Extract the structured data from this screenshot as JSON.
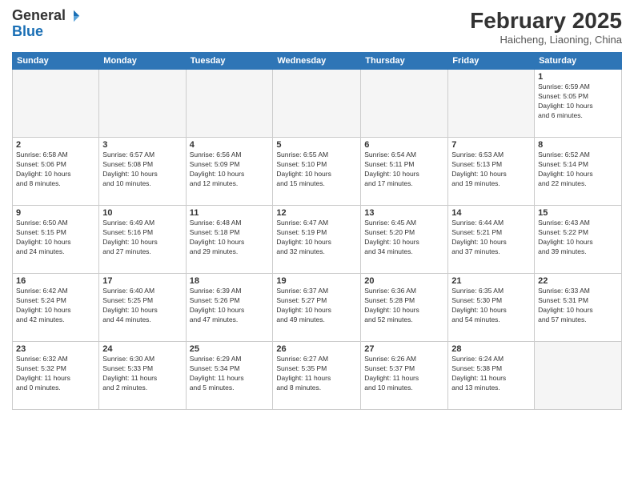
{
  "header": {
    "logo_general": "General",
    "logo_blue": "Blue",
    "month_title": "February 2025",
    "location": "Haicheng, Liaoning, China"
  },
  "weekdays": [
    "Sunday",
    "Monday",
    "Tuesday",
    "Wednesday",
    "Thursday",
    "Friday",
    "Saturday"
  ],
  "weeks": [
    [
      {
        "day": "",
        "info": ""
      },
      {
        "day": "",
        "info": ""
      },
      {
        "day": "",
        "info": ""
      },
      {
        "day": "",
        "info": ""
      },
      {
        "day": "",
        "info": ""
      },
      {
        "day": "",
        "info": ""
      },
      {
        "day": "1",
        "info": "Sunrise: 6:59 AM\nSunset: 5:05 PM\nDaylight: 10 hours\nand 6 minutes."
      }
    ],
    [
      {
        "day": "2",
        "info": "Sunrise: 6:58 AM\nSunset: 5:06 PM\nDaylight: 10 hours\nand 8 minutes."
      },
      {
        "day": "3",
        "info": "Sunrise: 6:57 AM\nSunset: 5:08 PM\nDaylight: 10 hours\nand 10 minutes."
      },
      {
        "day": "4",
        "info": "Sunrise: 6:56 AM\nSunset: 5:09 PM\nDaylight: 10 hours\nand 12 minutes."
      },
      {
        "day": "5",
        "info": "Sunrise: 6:55 AM\nSunset: 5:10 PM\nDaylight: 10 hours\nand 15 minutes."
      },
      {
        "day": "6",
        "info": "Sunrise: 6:54 AM\nSunset: 5:11 PM\nDaylight: 10 hours\nand 17 minutes."
      },
      {
        "day": "7",
        "info": "Sunrise: 6:53 AM\nSunset: 5:13 PM\nDaylight: 10 hours\nand 19 minutes."
      },
      {
        "day": "8",
        "info": "Sunrise: 6:52 AM\nSunset: 5:14 PM\nDaylight: 10 hours\nand 22 minutes."
      }
    ],
    [
      {
        "day": "9",
        "info": "Sunrise: 6:50 AM\nSunset: 5:15 PM\nDaylight: 10 hours\nand 24 minutes."
      },
      {
        "day": "10",
        "info": "Sunrise: 6:49 AM\nSunset: 5:16 PM\nDaylight: 10 hours\nand 27 minutes."
      },
      {
        "day": "11",
        "info": "Sunrise: 6:48 AM\nSunset: 5:18 PM\nDaylight: 10 hours\nand 29 minutes."
      },
      {
        "day": "12",
        "info": "Sunrise: 6:47 AM\nSunset: 5:19 PM\nDaylight: 10 hours\nand 32 minutes."
      },
      {
        "day": "13",
        "info": "Sunrise: 6:45 AM\nSunset: 5:20 PM\nDaylight: 10 hours\nand 34 minutes."
      },
      {
        "day": "14",
        "info": "Sunrise: 6:44 AM\nSunset: 5:21 PM\nDaylight: 10 hours\nand 37 minutes."
      },
      {
        "day": "15",
        "info": "Sunrise: 6:43 AM\nSunset: 5:22 PM\nDaylight: 10 hours\nand 39 minutes."
      }
    ],
    [
      {
        "day": "16",
        "info": "Sunrise: 6:42 AM\nSunset: 5:24 PM\nDaylight: 10 hours\nand 42 minutes."
      },
      {
        "day": "17",
        "info": "Sunrise: 6:40 AM\nSunset: 5:25 PM\nDaylight: 10 hours\nand 44 minutes."
      },
      {
        "day": "18",
        "info": "Sunrise: 6:39 AM\nSunset: 5:26 PM\nDaylight: 10 hours\nand 47 minutes."
      },
      {
        "day": "19",
        "info": "Sunrise: 6:37 AM\nSunset: 5:27 PM\nDaylight: 10 hours\nand 49 minutes."
      },
      {
        "day": "20",
        "info": "Sunrise: 6:36 AM\nSunset: 5:28 PM\nDaylight: 10 hours\nand 52 minutes."
      },
      {
        "day": "21",
        "info": "Sunrise: 6:35 AM\nSunset: 5:30 PM\nDaylight: 10 hours\nand 54 minutes."
      },
      {
        "day": "22",
        "info": "Sunrise: 6:33 AM\nSunset: 5:31 PM\nDaylight: 10 hours\nand 57 minutes."
      }
    ],
    [
      {
        "day": "23",
        "info": "Sunrise: 6:32 AM\nSunset: 5:32 PM\nDaylight: 11 hours\nand 0 minutes."
      },
      {
        "day": "24",
        "info": "Sunrise: 6:30 AM\nSunset: 5:33 PM\nDaylight: 11 hours\nand 2 minutes."
      },
      {
        "day": "25",
        "info": "Sunrise: 6:29 AM\nSunset: 5:34 PM\nDaylight: 11 hours\nand 5 minutes."
      },
      {
        "day": "26",
        "info": "Sunrise: 6:27 AM\nSunset: 5:35 PM\nDaylight: 11 hours\nand 8 minutes."
      },
      {
        "day": "27",
        "info": "Sunrise: 6:26 AM\nSunset: 5:37 PM\nDaylight: 11 hours\nand 10 minutes."
      },
      {
        "day": "28",
        "info": "Sunrise: 6:24 AM\nSunset: 5:38 PM\nDaylight: 11 hours\nand 13 minutes."
      },
      {
        "day": "",
        "info": ""
      }
    ]
  ]
}
